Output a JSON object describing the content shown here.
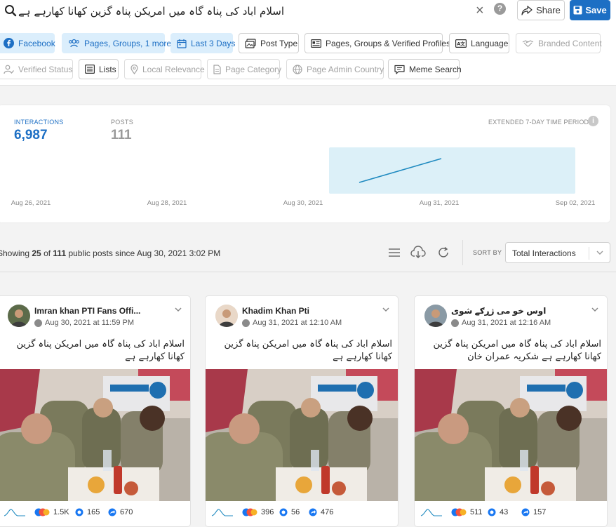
{
  "search": {
    "query": "اسلام اباد کی پناہ گاہ میں امریکن پناہ گزین کھانا کھارہے ہے",
    "share_label": "Share",
    "save_label": "Save"
  },
  "filters": {
    "row1": [
      {
        "label": "Facebook",
        "icon": "facebook-icon",
        "state": "active"
      },
      {
        "label": "Pages, Groups, 1 more",
        "icon": "people-icon",
        "state": "active"
      },
      {
        "label": "Last 3 Days",
        "icon": "calendar-icon",
        "state": "active"
      },
      {
        "label": "Post Type",
        "icon": "post-type-icon",
        "state": "normal"
      },
      {
        "label": "Pages, Groups & Verified Profiles",
        "icon": "list-card-icon",
        "state": "normal"
      },
      {
        "label": "Language",
        "icon": "language-icon",
        "state": "normal"
      },
      {
        "label": "Branded Content",
        "icon": "handshake-icon",
        "state": "disabled"
      }
    ],
    "row2": [
      {
        "label": "Verified Status",
        "icon": "verified-user-icon",
        "state": "disabled"
      },
      {
        "label": "Lists",
        "icon": "lists-icon",
        "state": "normal"
      },
      {
        "label": "Local Relevance",
        "icon": "location-pin-icon",
        "state": "disabled"
      },
      {
        "label": "Page Category",
        "icon": "page-icon",
        "state": "disabled"
      },
      {
        "label": "Page Admin Country",
        "icon": "globe-icon",
        "state": "disabled"
      },
      {
        "label": "Meme Search",
        "icon": "speech-bubble-icon",
        "state": "normal"
      }
    ]
  },
  "stats": {
    "interactions_label": "INTERACTIONS",
    "interactions_value": "6,987",
    "posts_label": "POSTS",
    "posts_value": "111",
    "period_label": "EXTENDED 7-DAY TIME PERIOD"
  },
  "chart_data": {
    "type": "line",
    "x_ticks": [
      "Aug 26, 2021",
      "Aug 28, 2021",
      "Aug 30, 2021",
      "Aug 31, 2021",
      "Sep 02, 2021"
    ],
    "highlight_range": [
      "Aug 30, 2021",
      "Sep 02, 2021"
    ],
    "series": [
      {
        "x": [
          "Aug 30, 2021",
          "Aug 31, 2021"
        ],
        "values": [
          0,
          1
        ]
      }
    ],
    "colors": {
      "line": "#1f8ac0",
      "highlight": "#dcf0f8"
    }
  },
  "results": {
    "prefix": "Showing ",
    "shown": "25",
    "of": " of ",
    "total": "111",
    "suffix": " public posts since Aug 30, 2021 3:02 PM",
    "sort_label": "SORT BY",
    "sort_value": "Total Interactions"
  },
  "posts": [
    {
      "name": "Imran khan PTI Fans Offi...",
      "date": "Aug 30, 2021 at 11:59 PM",
      "text": "اسلام اباد کی پناہ گاہ میں امریکن پناہ گزین کھانا کھارہے ہے",
      "reactions": "1.5K",
      "comments": "165",
      "shares": "670"
    },
    {
      "name": "Khadim Khan Pti",
      "date": "Aug 31, 2021 at 12:10 AM",
      "text": "اسلام اباد کی پناہ گاہ میں امریکن پناہ گزین کھانا کھارہے ہے",
      "reactions": "396",
      "comments": "56",
      "shares": "476"
    },
    {
      "name": "اوس خو می ژړګے شوی",
      "date": "Aug 31, 2021 at 12:16 AM",
      "text": "اسلام اباد کی پناہ گاہ میں امریکن پناہ گزین کھانا کھارہے ہے شکریہ عمران خان",
      "reactions": "511",
      "comments": "43",
      "shares": "157"
    }
  ],
  "colors": {
    "accent": "#1d6fc4",
    "active_chip_bg": "#dbeefc"
  }
}
